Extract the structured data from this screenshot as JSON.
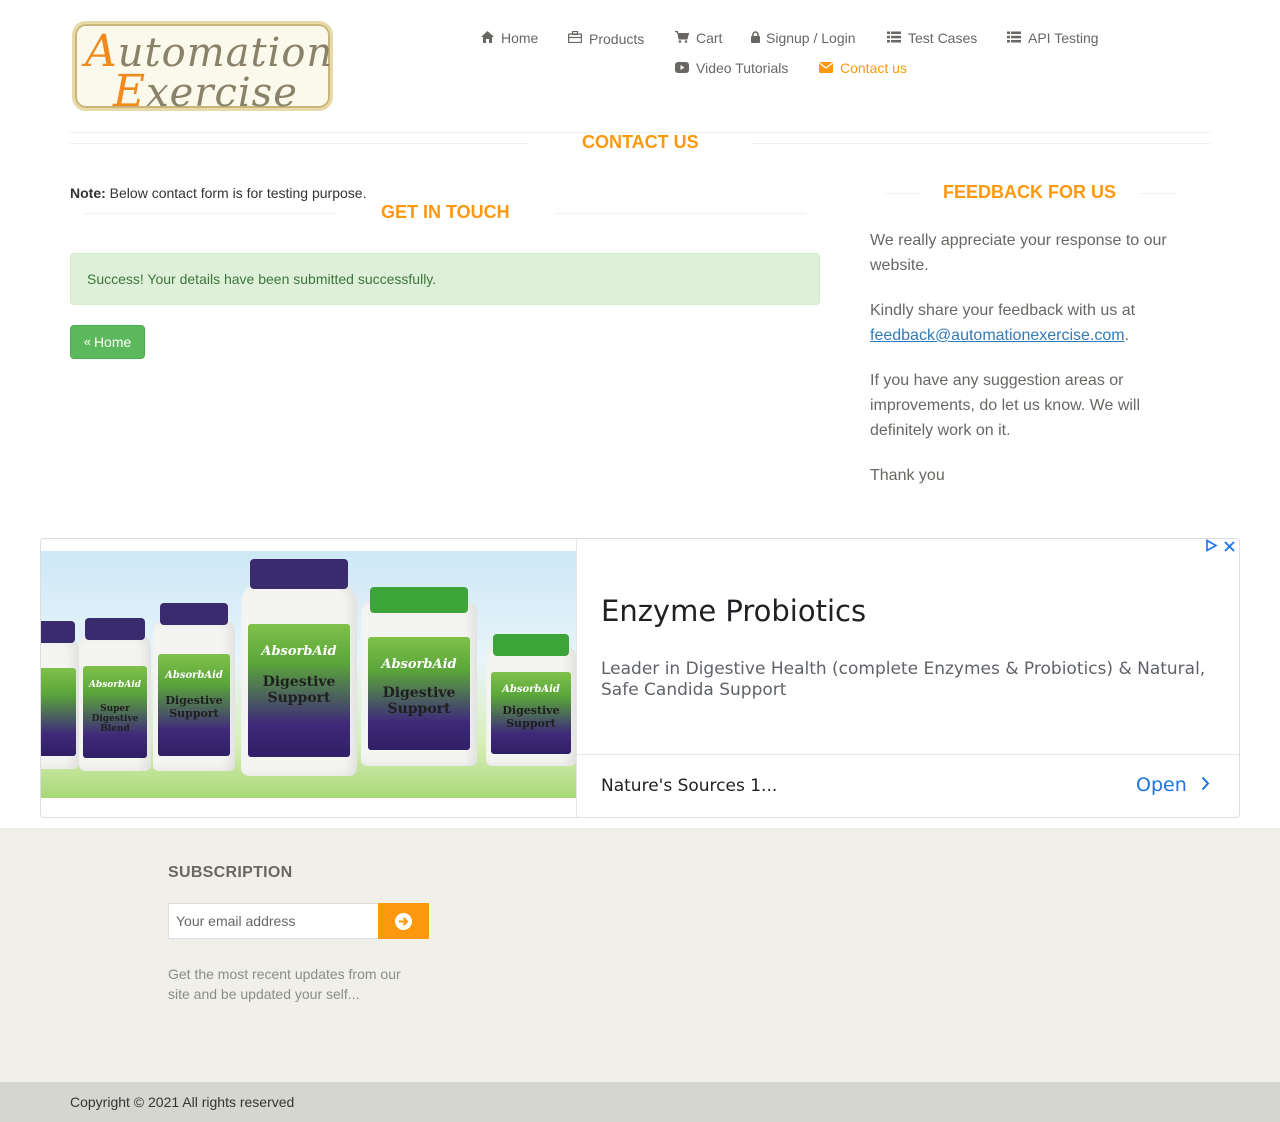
{
  "brand": {
    "logo_line1": "Automation",
    "logo_line2": "Exercise"
  },
  "nav": [
    {
      "label": "Home",
      "icon": "home-icon"
    },
    {
      "label": "Products",
      "icon": "products-icon"
    },
    {
      "label": "Cart",
      "icon": "cart-icon"
    },
    {
      "label": "Signup / Login",
      "icon": "lock-icon"
    },
    {
      "label": "Test Cases",
      "icon": "list-icon"
    },
    {
      "label": "API Testing",
      "icon": "list-icon"
    },
    {
      "label": "Video Tutorials",
      "icon": "youtube-icon"
    },
    {
      "label": "Contact us",
      "icon": "envelope-icon",
      "active": true
    }
  ],
  "contact": {
    "title": "Contact Us",
    "note_label": "Note:",
    "note_text": " Below contact form is for testing purpose.",
    "get_in_touch": "Get In Touch",
    "success_message": "Success! Your details have been submitted successfully.",
    "home_button": "Home"
  },
  "feedback": {
    "title": "Feedback For Us",
    "p1": "We really appreciate your response to our website.",
    "p2_before": "Kindly share your feedback with us at",
    "p2_email": "feedback@automationexercise.com",
    "p2_after": ".",
    "p3": "If you have any suggestion areas or improvements, do let us know. We will definitely work on it.",
    "p4": "Thank you"
  },
  "ad": {
    "headline": "Enzyme Probiotics",
    "description": "Leader in Digestive Health (complete Enzymes & Probiotics) & Natural, Safe Candida Support",
    "advertiser": "Nature's Sources 1...",
    "cta": "Open",
    "product_brand": "AbsorbAid",
    "product_labels": [
      "Super Digestive Blend",
      "Digestive Support",
      "Digestive Support",
      "Digestive Support",
      "Digestive Support"
    ]
  },
  "footer": {
    "subscription_title": "SUBSCRIPTION",
    "email_placeholder": "Your email address",
    "subscription_text": "Get the most recent updates from our site and be updated your self...",
    "copyright": "Copyright © 2021 All rights reserved"
  },
  "colors": {
    "accent": "#fe980f",
    "success_bg": "#dff0d8",
    "success_text": "#3c763d",
    "button_green": "#5cb85c",
    "link": "#337ab7",
    "footer_bg": "#f0f0e9",
    "footer_bottom_bg": "#d6d6d0"
  }
}
